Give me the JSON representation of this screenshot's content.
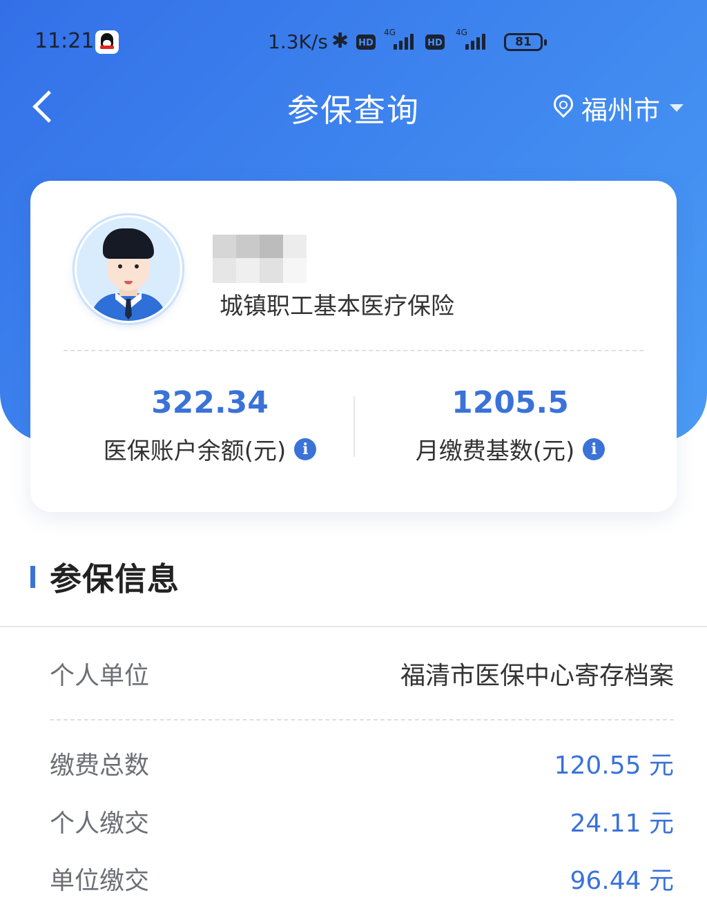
{
  "status_bar": {
    "time": "11:21",
    "net_speed": "1.3K/s",
    "hd_1": "HD",
    "hd_2": "HD",
    "net_1": "4G",
    "net_2": "4G",
    "battery": "81"
  },
  "nav": {
    "title": "参保查询",
    "city": "福州市"
  },
  "profile": {
    "insurance_type": "城镇职工基本医疗保险",
    "balance_value": "322.34",
    "balance_label": "医保账户余额(元)",
    "base_value": "1205.5",
    "base_label": "月缴费基数(元)",
    "info_glyph": "i"
  },
  "section": {
    "title": "参保信息"
  },
  "details": [
    {
      "label": "个人单位",
      "value": "福清市医保中心寄存档案"
    },
    {
      "label": "缴费总数",
      "value": "120.55 元"
    },
    {
      "label": "个人缴交",
      "value": "24.11 元"
    },
    {
      "label": "单位缴交",
      "value": "96.44 元"
    }
  ],
  "colors": {
    "accent": "#3a72d8",
    "header_start": "#3370e8",
    "header_end": "#4a9bf5"
  }
}
